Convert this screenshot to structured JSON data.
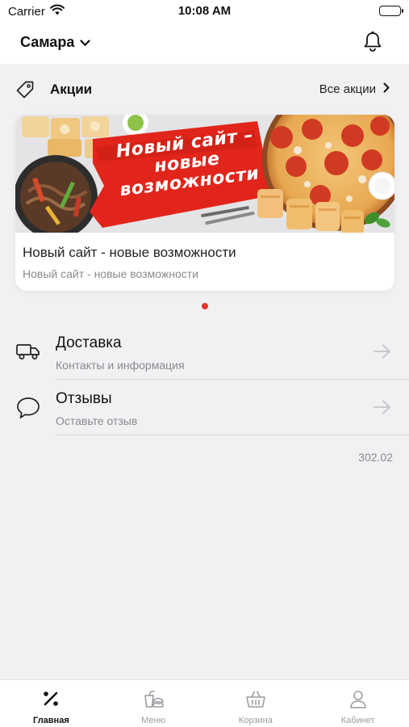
{
  "status_bar": {
    "carrier": "Carrier",
    "time": "10:08 AM"
  },
  "header": {
    "city": "Самара",
    "city_icon": "chevron-down-icon",
    "notifications_icon": "bell-icon"
  },
  "promo": {
    "title": "Акции",
    "icon": "tag-icon",
    "all_link": "Все акции",
    "cards": [
      {
        "banner_text_lines": [
          "Новый сайт –",
          "новые",
          "возможности"
        ],
        "title": "Новый сайт - новые возможности",
        "subtitle": "Новый сайт - новые возможности"
      }
    ],
    "active_dot_color": "#e63329"
  },
  "rows": [
    {
      "title": "Доставка",
      "subtitle": "Контакты и информация",
      "icon": "delivery-truck-icon"
    },
    {
      "title": "Отзывы",
      "subtitle": "Оставьте отзыв",
      "icon": "speech-bubble-icon"
    }
  ],
  "version": "302.02",
  "tabs": [
    {
      "label": "Главная",
      "icon": "percent-icon",
      "active": true
    },
    {
      "label": "Меню",
      "icon": "food-menu-icon",
      "active": false
    },
    {
      "label": "Корзина",
      "icon": "basket-icon",
      "active": false
    },
    {
      "label": "Кабинет",
      "icon": "user-icon",
      "active": false
    }
  ],
  "colors": {
    "accent": "#e63329",
    "background": "#f1f1f3",
    "muted_text": "#8a8a8e"
  }
}
